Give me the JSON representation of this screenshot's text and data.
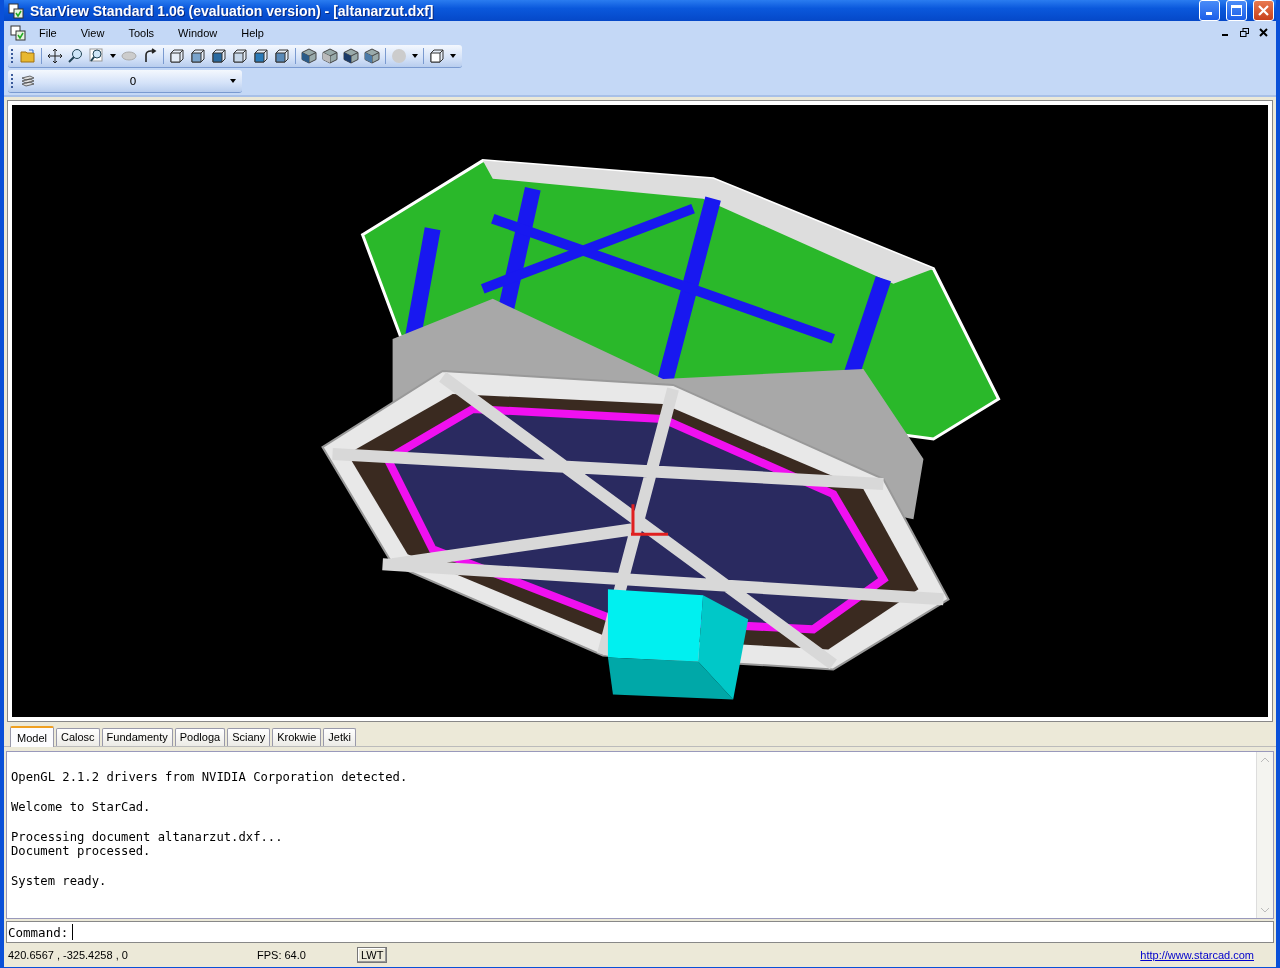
{
  "window": {
    "title": "StarView Standard 1.06 (evaluation version) - [altanarzut.dxf]"
  },
  "menu": [
    "File",
    "View",
    "Tools",
    "Window",
    "Help"
  ],
  "layer_combo": {
    "value": "0"
  },
  "tabs": [
    {
      "label": "Model",
      "selected": true
    },
    {
      "label": "Calosc",
      "selected": false
    },
    {
      "label": "Fundamenty",
      "selected": false
    },
    {
      "label": "Podloga",
      "selected": false
    },
    {
      "label": "Sciany",
      "selected": false
    },
    {
      "label": "Krokwie",
      "selected": false
    },
    {
      "label": "Jetki",
      "selected": false
    }
  ],
  "console": [
    [
      "OpenGL 2.1.2 drivers from NVIDIA Corporation detected."
    ],
    [
      "Welcome to StarCad."
    ],
    [
      "Processing document altanarzut.dxf...",
      "Document processed."
    ],
    [
      "System ready."
    ]
  ],
  "command": {
    "label": "Command:"
  },
  "status_bar": {
    "coordinates": "420.6567 , -325.4258 , 0",
    "fps": "FPS: 64.0",
    "lwt_button": "LWT",
    "link": "http://www.starcad.com"
  }
}
